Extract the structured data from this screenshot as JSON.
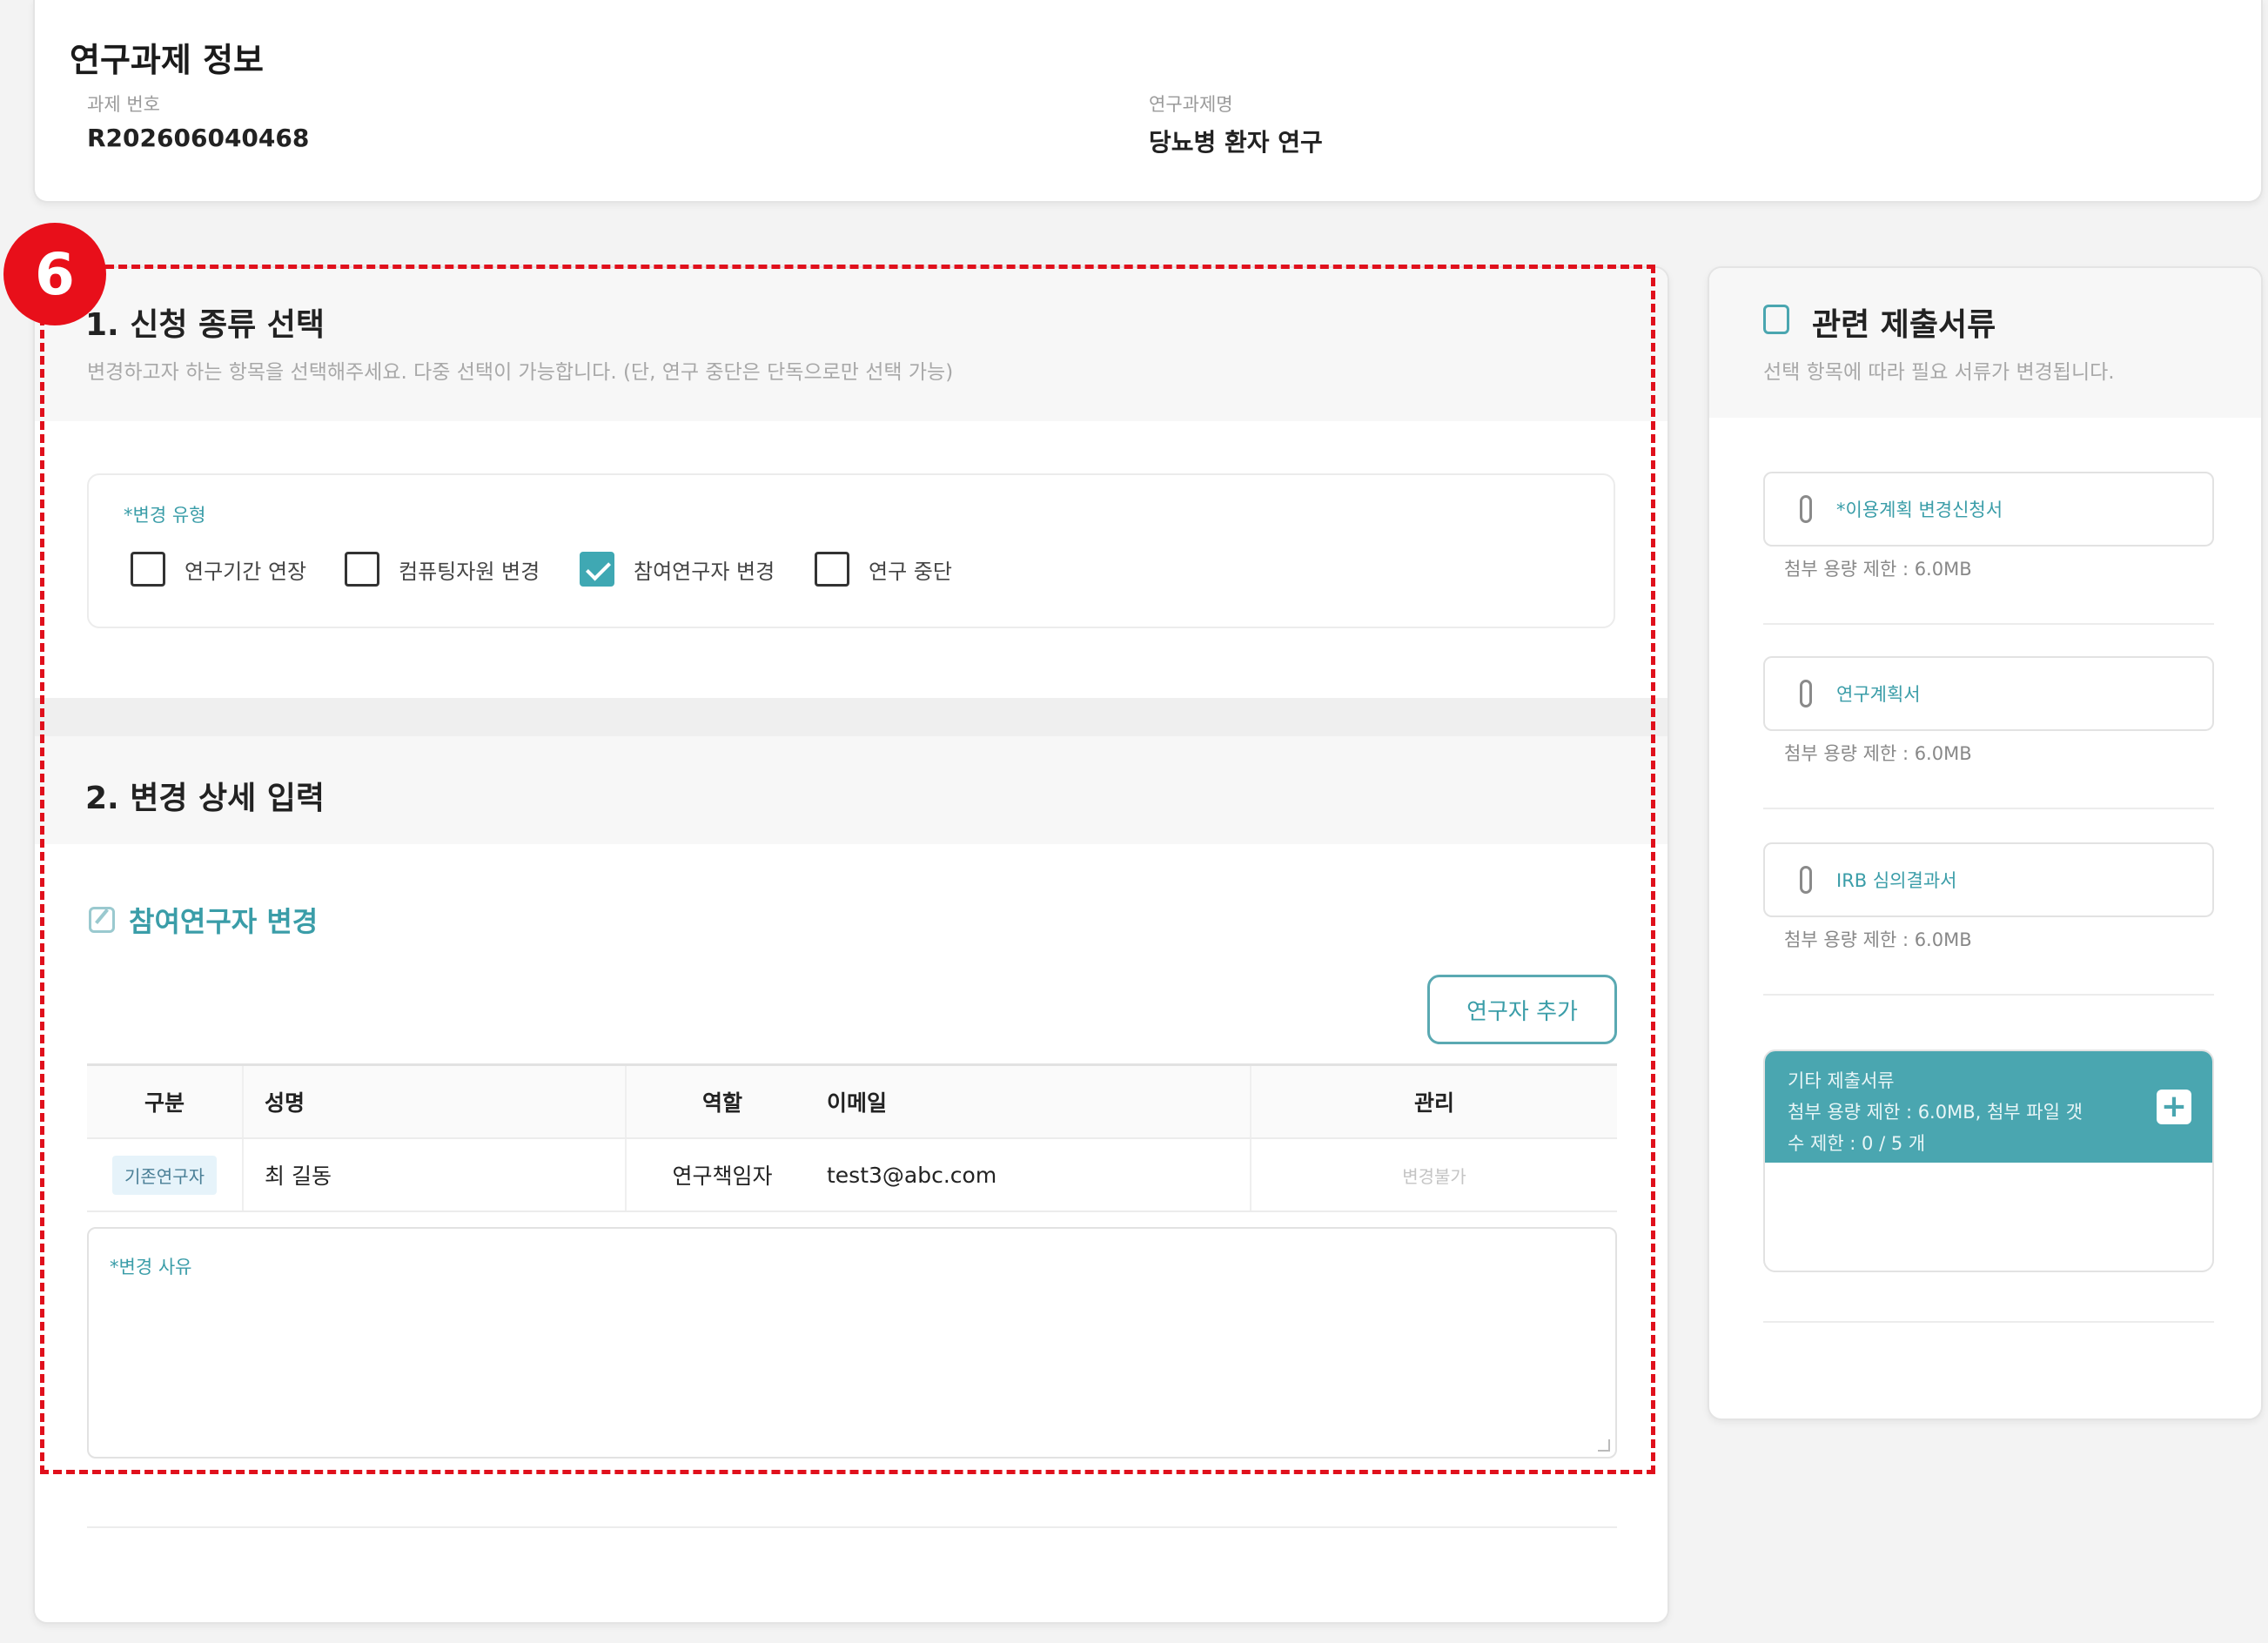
{
  "project": {
    "title": "연구과제 정보",
    "number_label": "과제 번호",
    "number_value": "R202606040468",
    "name_label": "연구과제명",
    "name_value": "당뇨병 환자 연구"
  },
  "section1": {
    "title": "1. 신청 종류 선택",
    "description": "변경하고자 하는 항목을 선택해주세요. 다중 선택이 가능합니다. (단, 연구 중단은 단독으로만 선택 가능)",
    "type_label": "*변경 유형",
    "options": [
      {
        "label": "연구기간 연장",
        "checked": false
      },
      {
        "label": "컴퓨팅자원 변경",
        "checked": false
      },
      {
        "label": "참여연구자 변경",
        "checked": true
      },
      {
        "label": "연구 중단",
        "checked": false
      }
    ]
  },
  "section2": {
    "title": "2. 변경 상세 입력",
    "subtitle": "참여연구자 변경",
    "add_button": "연구자 추가",
    "table": {
      "headers": [
        "구분",
        "성명",
        "역할",
        "이메일",
        "관리"
      ],
      "rows": [
        {
          "type": "기존연구자",
          "name": "최 길동",
          "role": "연구책임자",
          "email": "test3@abc.com",
          "action": "변경불가"
        }
      ]
    },
    "reason_label": "*변경 사유"
  },
  "side": {
    "title": "관련 제출서류",
    "description": "선택 항목에 따라 필요 서류가 변경됩니다.",
    "documents": [
      {
        "name": "*이용계획 변경신청서",
        "limit": "첨부 용량 제한 : 6.0MB"
      },
      {
        "name": "연구계획서",
        "limit": "첨부 용량 제한 : 6.0MB"
      },
      {
        "name": "IRB 심의결과서",
        "limit": "첨부 용량 제한 : 6.0MB"
      }
    ],
    "etc": {
      "title": "기타 제출서류",
      "line1": "첨부 용량 제한 : 6.0MB, 첨부 파일 갯",
      "line2": "수 제한 : 0 / 5 개",
      "add_icon": "plus-icon"
    }
  },
  "annotation": {
    "step": "6",
    "color": "#e0101c"
  },
  "colors": {
    "accent": "#3a9da8",
    "header_teal": "#4aa6b0"
  }
}
